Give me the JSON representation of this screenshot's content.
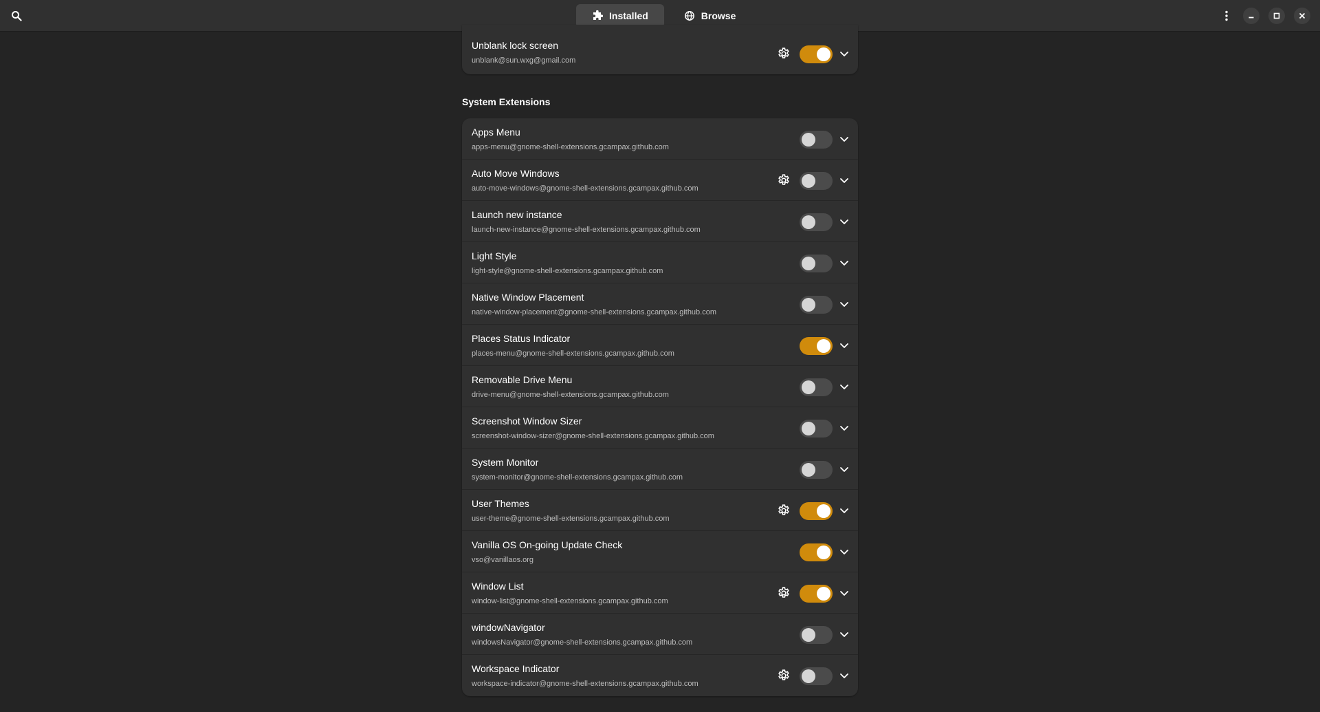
{
  "header": {
    "tabs": [
      {
        "label": "Installed",
        "icon": "puzzle-icon",
        "active": true
      },
      {
        "label": "Browse",
        "icon": "globe-icon",
        "active": false
      }
    ]
  },
  "colors": {
    "accent": "#d08b0c",
    "background": "#242424",
    "card": "#303030"
  },
  "user_extensions": [
    {
      "title": "Unblank lock screen",
      "uuid": "unblank@sun.wxg@gmail.com",
      "settings": true,
      "enabled": true
    }
  ],
  "system_section": {
    "title": "System Extensions"
  },
  "system_extensions": [
    {
      "title": "Apps Menu",
      "uuid": "apps-menu@gnome-shell-extensions.gcampax.github.com",
      "settings": false,
      "enabled": false
    },
    {
      "title": "Auto Move Windows",
      "uuid": "auto-move-windows@gnome-shell-extensions.gcampax.github.com",
      "settings": true,
      "enabled": false
    },
    {
      "title": "Launch new instance",
      "uuid": "launch-new-instance@gnome-shell-extensions.gcampax.github.com",
      "settings": false,
      "enabled": false
    },
    {
      "title": "Light Style",
      "uuid": "light-style@gnome-shell-extensions.gcampax.github.com",
      "settings": false,
      "enabled": false
    },
    {
      "title": "Native Window Placement",
      "uuid": "native-window-placement@gnome-shell-extensions.gcampax.github.com",
      "settings": false,
      "enabled": false
    },
    {
      "title": "Places Status Indicator",
      "uuid": "places-menu@gnome-shell-extensions.gcampax.github.com",
      "settings": false,
      "enabled": true
    },
    {
      "title": "Removable Drive Menu",
      "uuid": "drive-menu@gnome-shell-extensions.gcampax.github.com",
      "settings": false,
      "enabled": false
    },
    {
      "title": "Screenshot Window Sizer",
      "uuid": "screenshot-window-sizer@gnome-shell-extensions.gcampax.github.com",
      "settings": false,
      "enabled": false
    },
    {
      "title": "System Monitor",
      "uuid": "system-monitor@gnome-shell-extensions.gcampax.github.com",
      "settings": false,
      "enabled": false
    },
    {
      "title": "User Themes",
      "uuid": "user-theme@gnome-shell-extensions.gcampax.github.com",
      "settings": true,
      "enabled": true
    },
    {
      "title": "Vanilla OS On-going Update Check",
      "uuid": "vso@vanillaos.org",
      "settings": false,
      "enabled": true
    },
    {
      "title": "Window List",
      "uuid": "window-list@gnome-shell-extensions.gcampax.github.com",
      "settings": true,
      "enabled": true
    },
    {
      "title": "windowNavigator",
      "uuid": "windowsNavigator@gnome-shell-extensions.gcampax.github.com",
      "settings": false,
      "enabled": false
    },
    {
      "title": "Workspace Indicator",
      "uuid": "workspace-indicator@gnome-shell-extensions.gcampax.github.com",
      "settings": true,
      "enabled": false
    }
  ]
}
